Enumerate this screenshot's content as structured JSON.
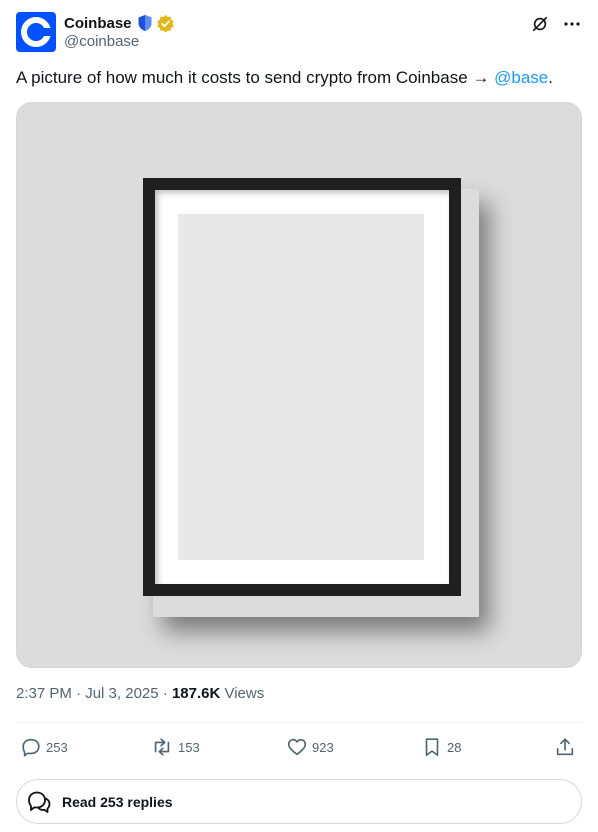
{
  "author": {
    "display_name": "Coinbase",
    "handle": "@coinbase",
    "avatar_icon": "coinbase-logo",
    "badges": [
      "shield-badge-icon",
      "verified-gold-icon"
    ]
  },
  "header_actions": [
    "grok-icon",
    "more-icon"
  ],
  "tweet": {
    "text_before": "A picture of how much it costs to send crypto from Coinbase → ",
    "mention": "@base",
    "text_after": "."
  },
  "meta": {
    "time": "2:37 PM",
    "sep1": " · ",
    "date": "Jul 3, 2025",
    "sep2": " · ",
    "views_count": "187.6K",
    "views_label": " Views"
  },
  "actions": {
    "replies": "253",
    "reposts": "153",
    "likes": "923",
    "bookmarks": "28"
  },
  "read_replies": "Read 253 replies",
  "colors": {
    "brand": "#0052ff",
    "link": "#1d9bf0",
    "muted": "#536471",
    "verified": "#e2b719"
  }
}
